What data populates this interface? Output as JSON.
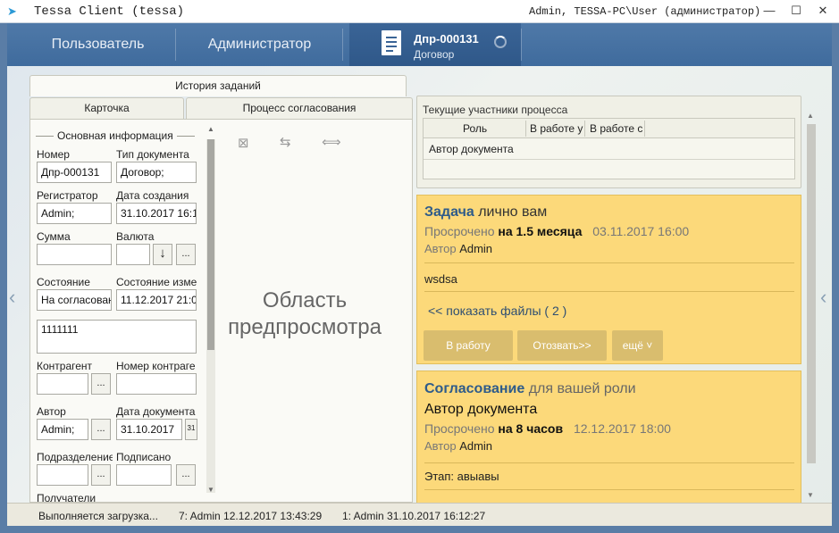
{
  "window": {
    "title": "Tessa Client (tessa)",
    "user": "Admin, TESSA-PC\\User (администратор)",
    "minimize": "—",
    "maximize": "☐",
    "close": "✕"
  },
  "nav": {
    "tabs": [
      "Пользователь",
      "Администратор"
    ],
    "active_doc": {
      "number": "Дпр-000131",
      "type": "Договор"
    }
  },
  "card_tabs": {
    "history": "История заданий",
    "card": "Карточка",
    "process": "Процесс согласования"
  },
  "form": {
    "group_title": "Основная информация",
    "number_label": "Номер",
    "number_value": "Дпр-000131",
    "doctype_label": "Тип документа",
    "doctype_value": "Договор;",
    "registrar_label": "Регистратор",
    "registrar_value": "Admin;",
    "created_label": "Дата создания",
    "created_value": "31.10.2017  16:1",
    "sum_label": "Сумма",
    "sum_value": "",
    "currency_label": "Валюта",
    "currency_value": "",
    "state_label": "Состояние",
    "state_value": "На согласован",
    "state_changed_label": "Состояние изме",
    "state_changed_value": "11.12.2017  21:0",
    "description_value": "1111111",
    "contractor_label": "Контрагент",
    "contractor_value": "",
    "contract_no_label": "Номер контраге",
    "contract_no_value": "",
    "author_label": "Автор",
    "author_value": "Admin;",
    "docdate_label": "Дата документа",
    "docdate_value": "31.10.2017",
    "department_label": "Подразделение",
    "department_value": "",
    "signed_label": "Подписано",
    "signed_value": "",
    "recipients_label": "Получатели",
    "ellipsis": "...",
    "down_arrow": "↓",
    "calendar": "31"
  },
  "preview": {
    "text": "Область предпросмотра",
    "tools": [
      "⊠",
      "⇆",
      "⟺"
    ]
  },
  "participants": {
    "title": "Текущие участники процесса",
    "columns": [
      "Роль",
      "В работе у",
      "В работе с"
    ],
    "rows": [
      "Автор документа"
    ]
  },
  "task1": {
    "kind": "Задача",
    "sub": "лично вам",
    "overdue_prefix": "Просрочено",
    "overdue_value": "на 1.5 месяца",
    "date": "03.11.2017 16:00",
    "author_prefix": "Автор",
    "author": "Admin",
    "text": "wsdsa",
    "files_link": "<< показать файлы ( 2 )",
    "btn_work": "В работу",
    "btn_revoke": "Отозвать>>",
    "btn_more": "ещё ˅"
  },
  "task2": {
    "kind": "Согласование",
    "sub": "для вашей роли",
    "role": "Автор документа",
    "overdue_prefix": "Просрочено",
    "overdue_value": "на 8 часов",
    "date": "12.12.2017 18:00",
    "author_prefix": "Автор",
    "author": "Admin",
    "stage": "Этап: авыавы"
  },
  "status": {
    "loading": "Выполняется загрузка...",
    "item1": "7:  Admin  12.12.2017 13:43:29",
    "item2": "1:  Admin  31.10.2017 16:12:27"
  },
  "colors": {
    "nav_bg": "#4f79a8",
    "task_bg": "#fcd97a",
    "task_title": "#2e5b8a",
    "task_button": "#d9bd6e"
  }
}
